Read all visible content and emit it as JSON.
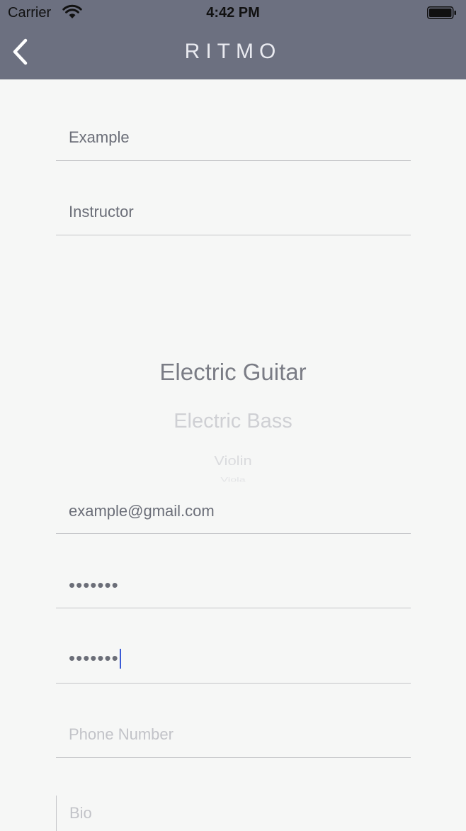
{
  "status_bar": {
    "carrier": "Carrier",
    "time": "4:42 PM"
  },
  "nav": {
    "title": "RITMO",
    "back_icon": "chevron-left-icon"
  },
  "form": {
    "first_name": {
      "value": "Example"
    },
    "role": {
      "value": "Instructor"
    },
    "instrument_picker": {
      "selected": "Electric Guitar",
      "visible_options": [
        "Electric Guitar",
        "Electric Bass",
        "Violin",
        "Viola"
      ]
    },
    "email": {
      "value": "example@gmail.com"
    },
    "password": {
      "value": "•••••••"
    },
    "confirm_password": {
      "value": "•••••••"
    },
    "phone": {
      "value": "",
      "placeholder": "Phone Number"
    },
    "bio": {
      "value": "",
      "placeholder": "Bio"
    }
  },
  "colors": {
    "header_bg": "#6c7080",
    "page_bg": "#f6f7f6",
    "caret": "#3b5bd6"
  }
}
